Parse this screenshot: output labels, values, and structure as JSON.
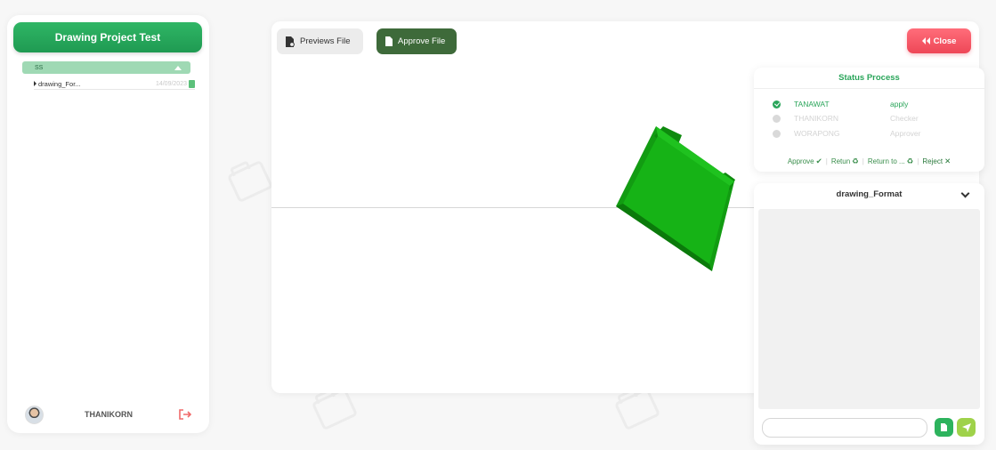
{
  "sidebar": {
    "project_title": "Drawing Project Test",
    "folder": {
      "name": "SS"
    },
    "files": [
      {
        "name": "drawing_For...",
        "date": "14/09/2023"
      }
    ],
    "user": {
      "name": "THANIKORN"
    }
  },
  "toolbar": {
    "preview_label": "Previews File",
    "approve_label": "Approve File",
    "close_label": "Close"
  },
  "status": {
    "title": "Status Process",
    "steps": [
      {
        "name": "TANAWAT",
        "role": "apply",
        "state": "done"
      },
      {
        "name": "THANIKORN",
        "role": "Checker",
        "state": "pending"
      },
      {
        "name": "WORAPONG",
        "role": "Approver",
        "state": "pending"
      }
    ],
    "actions": {
      "approve": "Approve",
      "return": "Retun",
      "return_to": "Return to ...",
      "reject": "Reject"
    }
  },
  "chat": {
    "title": "drawing_Format",
    "input_value": ""
  },
  "colors": {
    "primary_green": "#2aa55a",
    "approve_dark": "#3e6a3a",
    "close_red": "#ee4757",
    "model_green": "#12a812"
  }
}
